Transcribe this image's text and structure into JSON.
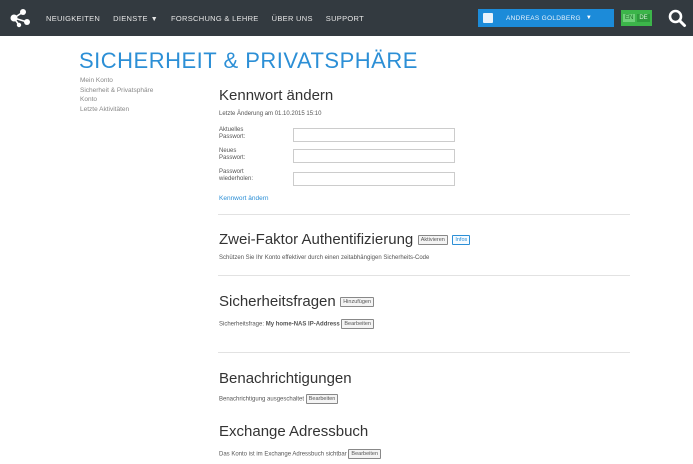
{
  "nav": {
    "items": [
      {
        "label": "NEUIGKEITEN",
        "has_dropdown": false
      },
      {
        "label": "DIENSTE",
        "has_dropdown": true
      },
      {
        "label": "FORSCHUNG & LEHRE",
        "has_dropdown": false
      },
      {
        "label": "ÜBER UNS",
        "has_dropdown": false
      },
      {
        "label": "SUPPORT",
        "has_dropdown": false
      }
    ],
    "user_name": "ANDREAS GOLDBERG",
    "languages": [
      "EN",
      "DE"
    ],
    "active_language": "DE"
  },
  "page_title": "SICHERHEIT & PRIVATSPHÄRE",
  "sidebar": {
    "items": [
      {
        "label": "Mein Konto"
      },
      {
        "label": "Sicherheit & Privatsphäre"
      },
      {
        "label": "Konto"
      },
      {
        "label": "Letzte Aktivitäten"
      }
    ]
  },
  "password": {
    "heading": "Kennwort ändern",
    "last_change": "Letzte Änderung am 01.10.2015 15:10",
    "fields": [
      {
        "label_line1": "Aktuelles",
        "label_line2": "Passwort:",
        "value": ""
      },
      {
        "label_line1": "Neues",
        "label_line2": "Passwort:",
        "value": ""
      },
      {
        "label_line1": "Passwort",
        "label_line2": "wiederholen:",
        "value": ""
      }
    ],
    "submit_link": "Kennwort ändern"
  },
  "two_factor": {
    "heading": "Zwei-Faktor Authentifizierung",
    "activate_button": "Aktivieren",
    "info_button": "Infos",
    "description": "Schützen Sie Ihr Konto effektiver durch einen zeitabhängigen Sicherheits-Code"
  },
  "security_questions": {
    "heading": "Sicherheitsfragen",
    "add_button": "Hinzufügen",
    "question_label": "Sicherheitsfrage:",
    "question_value": "My home-NAS IP-Address",
    "edit_button": "Bearbeiten"
  },
  "notifications": {
    "heading": "Benachrichtigungen",
    "status_text": "Benachrichtigung ausgeschaltet",
    "edit_button": "Bearbeiten"
  },
  "exchange": {
    "heading": "Exchange Adressbuch",
    "status_text": "Das Konto ist im Exchange Adressbuch sichtbar",
    "edit_button": "Bearbeiten"
  },
  "colors": {
    "topbar": "#333a40",
    "accent": "#2c8fd6",
    "user_box": "#1c8bd9",
    "lang_green": "#3cb54a"
  }
}
